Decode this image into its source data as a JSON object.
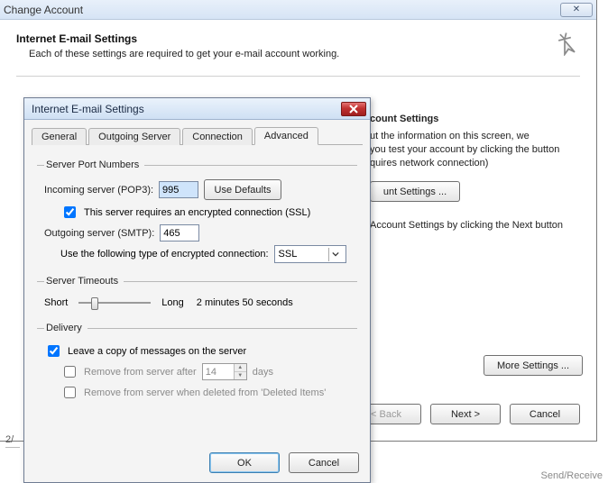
{
  "outer": {
    "title": "Change Account",
    "header_title": "Internet E-mail Settings",
    "header_sub": "Each of these settings are required to get your e-mail account working.",
    "right": {
      "title": "count Settings",
      "desc_l1": "ut the information on this screen, we",
      "desc_l2": "you test your account by clicking the button",
      "desc_l3": "quires network connection)",
      "test_btn": "unt Settings ...",
      "note": "Account Settings by clicking the Next button",
      "more_btn": "More Settings ..."
    },
    "buttons": {
      "back": "< Back",
      "next": "Next >",
      "cancel": "Cancel"
    }
  },
  "modal": {
    "title": "Internet E-mail Settings",
    "tabs": {
      "general": "General",
      "outgoing": "Outgoing Server",
      "connection": "Connection",
      "advanced": "Advanced"
    },
    "groups": {
      "ports": "Server Port Numbers",
      "timeouts": "Server Timeouts",
      "delivery": "Delivery"
    },
    "fields": {
      "incoming_label": "Incoming server (POP3):",
      "incoming_value": "995",
      "use_defaults": "Use Defaults",
      "ssl_checkbox": "This server requires an encrypted connection (SSL)",
      "outgoing_label": "Outgoing server (SMTP):",
      "outgoing_value": "465",
      "enc_label": "Use the following type of encrypted connection:",
      "enc_value": "SSL",
      "timeout_short": "Short",
      "timeout_long": "Long",
      "timeout_value": "2 minutes 50 seconds",
      "leave_copy": "Leave a copy of messages on the server",
      "remove_after_pre": "Remove from server after",
      "remove_after_days": "14",
      "remove_after_post": "days",
      "remove_deleted": "Remove from server when deleted from 'Deleted Items'"
    },
    "buttons": {
      "ok": "OK",
      "cancel": "Cancel"
    }
  },
  "status": "Send/Receive",
  "frag": "2/"
}
